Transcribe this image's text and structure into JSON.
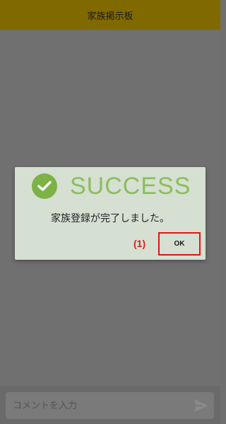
{
  "header": {
    "title": "家族掲示板"
  },
  "dialog": {
    "status_text": "SUCCESS",
    "message": "家族登録が完了しました。",
    "annotation_label": "(1)",
    "ok_label": "OK",
    "icon": "check-circle-icon",
    "accent_color": "#7db247",
    "highlight_color": "#e01515"
  },
  "footer": {
    "comment_placeholder": "コメントを入力",
    "send_icon": "send-icon"
  },
  "colors": {
    "header_bg": "#806a00",
    "overlay_bg": "#707070"
  }
}
